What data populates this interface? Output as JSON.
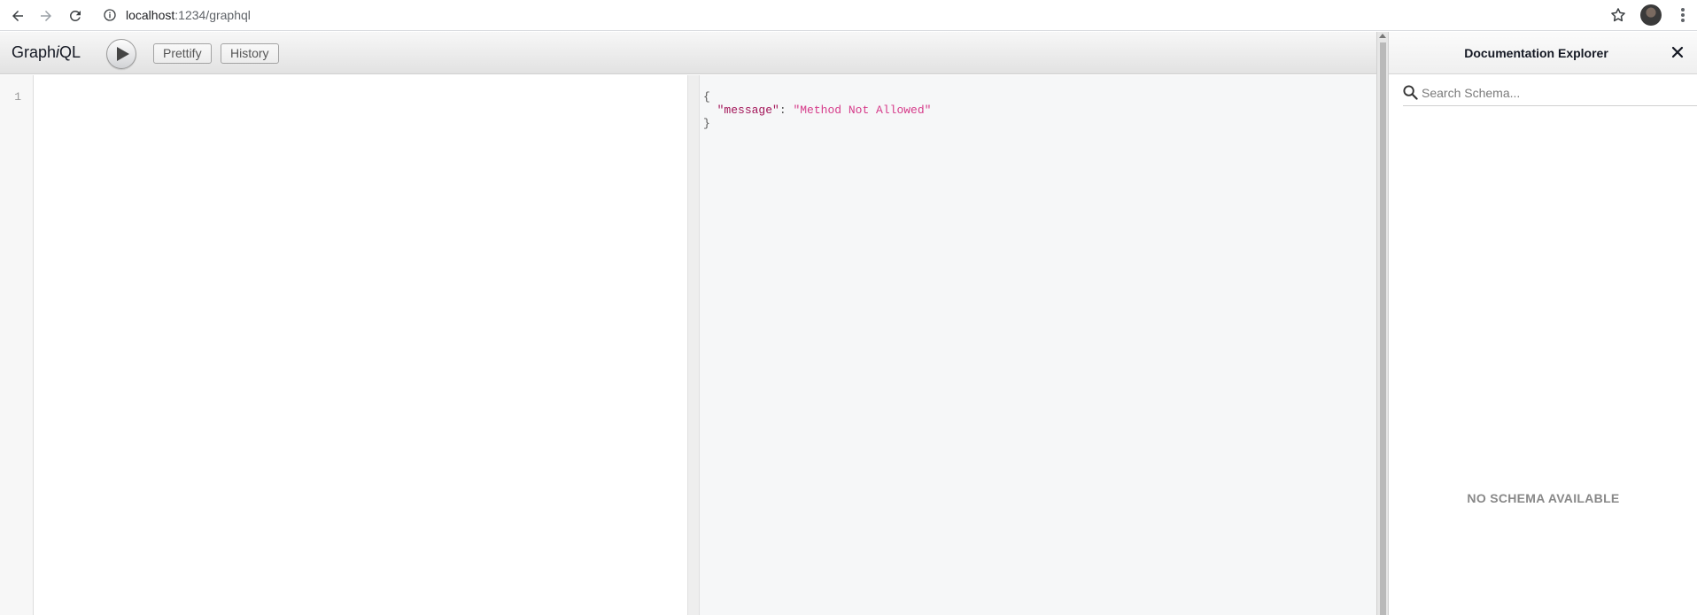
{
  "browser": {
    "url_host": "localhost",
    "url_path": ":1234/graphql"
  },
  "toolbar": {
    "title_prefix": "Graph",
    "title_italic": "i",
    "title_suffix": "QL",
    "prettify_label": "Prettify",
    "history_label": "History"
  },
  "editor": {
    "line_number": "1"
  },
  "result": {
    "open_brace": "{",
    "indent": "  ",
    "key": "\"message\"",
    "separator": ": ",
    "value": "\"Method Not Allowed\"",
    "close_brace": "}"
  },
  "doc_explorer": {
    "title": "Documentation Explorer",
    "search_placeholder": "Search Schema...",
    "empty_message": "NO SCHEMA AVAILABLE"
  }
}
